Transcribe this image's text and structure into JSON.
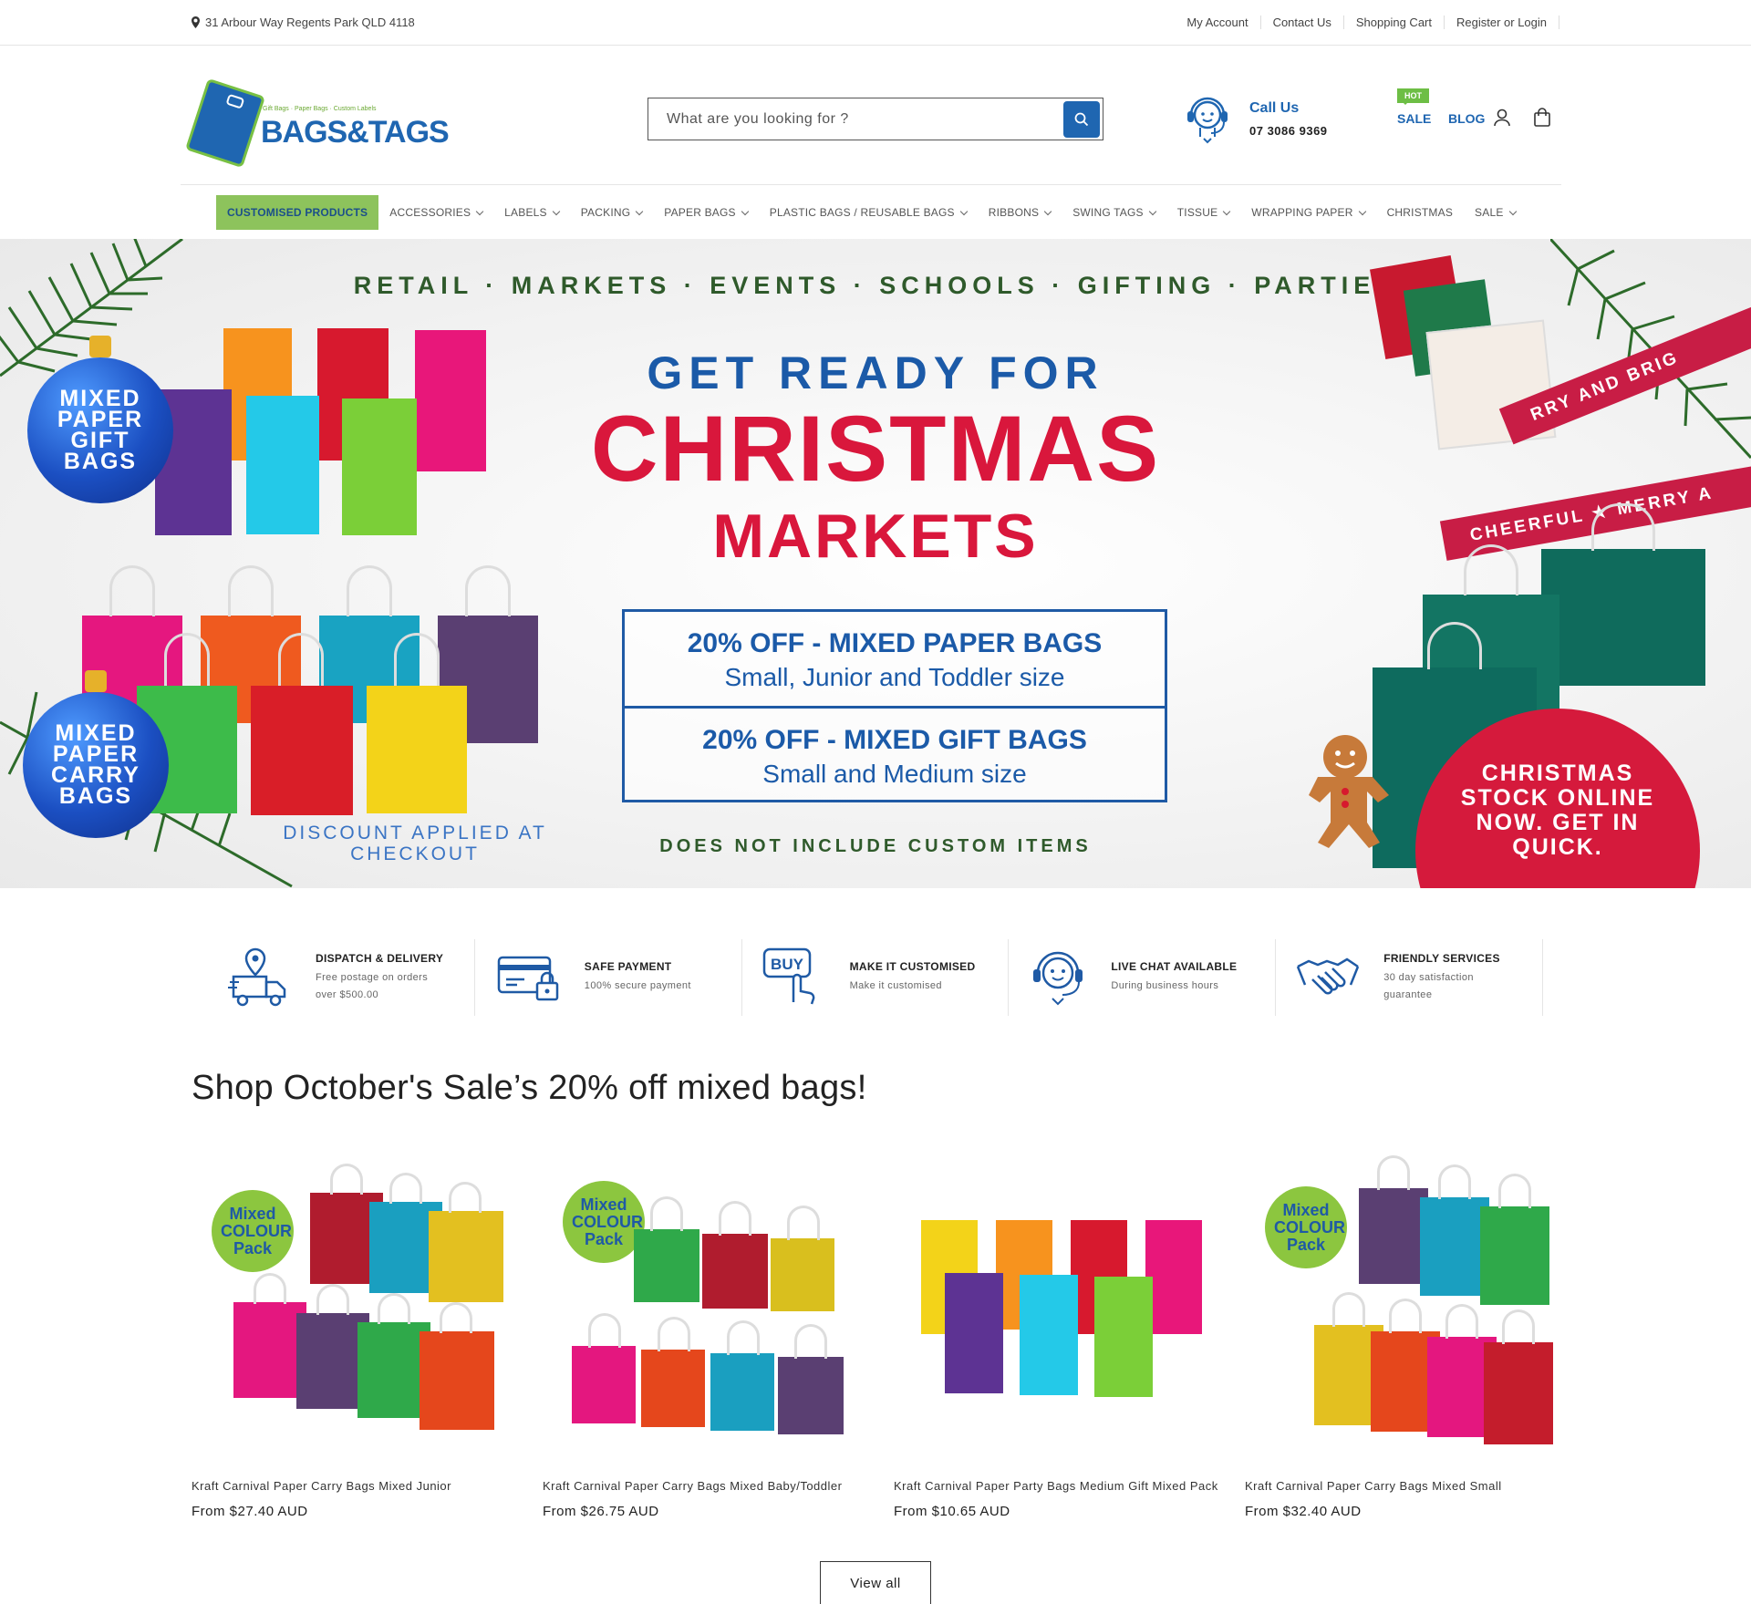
{
  "topbar": {
    "address": "31 Arbour Way Regents Park QLD 4118",
    "links": [
      "My Account",
      "Contact Us",
      "Shopping Cart",
      "Register or Login"
    ]
  },
  "header": {
    "logo_text": "BAGS&TAGS",
    "logo_tagline": "Gift Bags · Paper Bags · Custom Labels",
    "search_placeholder": "What are you looking for ?",
    "call_label": "Call Us",
    "call_number": "07 3086 9369",
    "hot_badge": "HOT",
    "sale_label": "SALE",
    "blog_label": "BLOG"
  },
  "nav": {
    "items": [
      {
        "label": "CUSTOMISED PRODUCTS",
        "dropdown": false
      },
      {
        "label": "ACCESSORIES",
        "dropdown": true
      },
      {
        "label": "LABELS",
        "dropdown": true
      },
      {
        "label": "PACKING",
        "dropdown": true
      },
      {
        "label": "PAPER BAGS",
        "dropdown": true
      },
      {
        "label": "PLASTIC BAGS / REUSABLE BAGS",
        "dropdown": true
      },
      {
        "label": "RIBBONS",
        "dropdown": true
      },
      {
        "label": "SWING TAGS",
        "dropdown": true
      },
      {
        "label": "TISSUE",
        "dropdown": true
      },
      {
        "label": "WRAPPING PAPER",
        "dropdown": true
      },
      {
        "label": "CHRISTMAS",
        "dropdown": false
      },
      {
        "label": "SALE",
        "dropdown": true
      }
    ]
  },
  "hero": {
    "categories": "RETAIL · MARKETS · EVENTS · SCHOOLS · GIFTING · PARTIES",
    "headline1": "GET READY FOR",
    "headline2": "CHRISTMAS",
    "headline3": "MARKETS",
    "offer1_title": "20% OFF - MIXED PAPER BAGS",
    "offer1_sub": "Small, Junior and Toddler size",
    "offer2_title": "20% OFF - MIXED GIFT BAGS",
    "offer2_sub": "Small and Medium size",
    "disclaimer": "DOES NOT INCLUDE CUSTOM ITEMS",
    "discount_note": "DISCOUNT APPLIED AT CHECKOUT",
    "bauble1": "MIXED PAPER GIFT BAGS",
    "bauble2": "MIXED PAPER CARRY BAGS",
    "stock_note": "CHRISTMAS STOCK ONLINE NOW. GET IN QUICK.",
    "ribbon1": "RRY AND BRIG",
    "ribbon2": "CHEERFUL ★ MERRY A"
  },
  "features": [
    {
      "title": "DISPATCH & DELIVERY",
      "desc": "Free postage on orders over $500.00",
      "icon": "delivery-truck-icon"
    },
    {
      "title": "SAFE PAYMENT",
      "desc": "100% secure payment",
      "icon": "secure-card-icon"
    },
    {
      "title": "MAKE IT CUSTOMISED",
      "desc": "Make it customised",
      "icon": "buy-click-icon"
    },
    {
      "title": "LIVE CHAT AVAILABLE",
      "desc": "During business hours",
      "icon": "headset-icon"
    },
    {
      "title": "FRIENDLY SERVICES",
      "desc": "30 day satisfaction guarantee",
      "icon": "handshake-icon"
    }
  ],
  "section": {
    "title": "Shop October's Sale’s 20% off mixed bags!",
    "view_all": "View all"
  },
  "badge_text": "Mixed COLOUR Pack",
  "products": [
    {
      "name": "Kraft Carnival Paper Carry Bags Mixed Junior",
      "price": "From $27.40 AUD"
    },
    {
      "name": "Kraft Carnival Paper Carry Bags Mixed Baby/Toddler",
      "price": "From $26.75 AUD"
    },
    {
      "name": "Kraft Carnival Paper Party Bags Medium Gift Mixed Pack",
      "price": "From $10.65 AUD"
    },
    {
      "name": "Kraft Carnival Paper Carry Bags Mixed Small",
      "price": "From $32.40 AUD"
    }
  ],
  "colors": {
    "brand_blue": "#1f66b1",
    "brand_green": "#8dc35c",
    "hero_red": "#d9173c"
  }
}
